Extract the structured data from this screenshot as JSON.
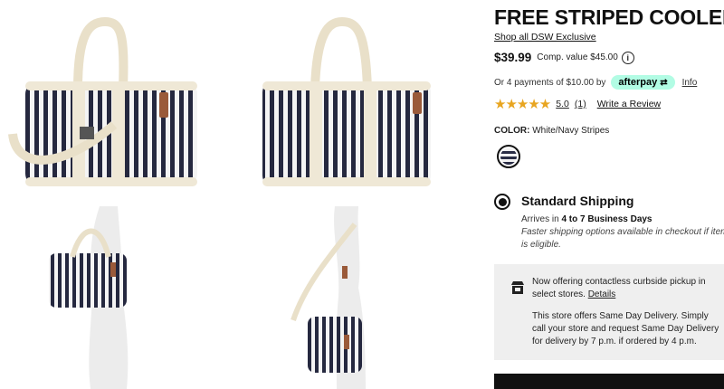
{
  "gallery": {
    "images": [
      "bag-front",
      "bag-side",
      "bag-on-mannequin-shoulder",
      "bag-on-mannequin-crossbody"
    ]
  },
  "product": {
    "title": "FREE STRIPED COOLER",
    "shop_link": "Shop all DSW Exclusive",
    "price": "$39.99",
    "comp_value": "Comp. value $45.00",
    "afterpay_text": "Or 4 payments of $10.00 by",
    "afterpay_brand": "afterpay",
    "afterpay_info": "Info",
    "stars": "★★★★★",
    "rating_value": "5.0",
    "rating_count": "(1)",
    "write_review": "Write a Review",
    "color_label": "COLOR:",
    "color_value": "White/Navy Stripes"
  },
  "shipping": {
    "title": "Standard Shipping",
    "arrives_prefix": "Arrives in ",
    "arrives_days": "4 to 7 Business Days",
    "faster_note": "Faster shipping options available in checkout if item is eligible."
  },
  "store": {
    "curbside_text": "Now offering contactless curbside pickup in select stores.",
    "details_link": "Details",
    "sameday_text": "This store offers Same Day Delivery. Simply call your store and request Same Day Delivery for delivery by 7 p.m. if ordered by 4 p.m."
  },
  "colors": {
    "navy": "#2a2d45",
    "cream": "#f1ead8",
    "afterpay_mint": "#b2fce4",
    "star_gold": "#e8a520",
    "store_box_bg": "#efefef"
  }
}
